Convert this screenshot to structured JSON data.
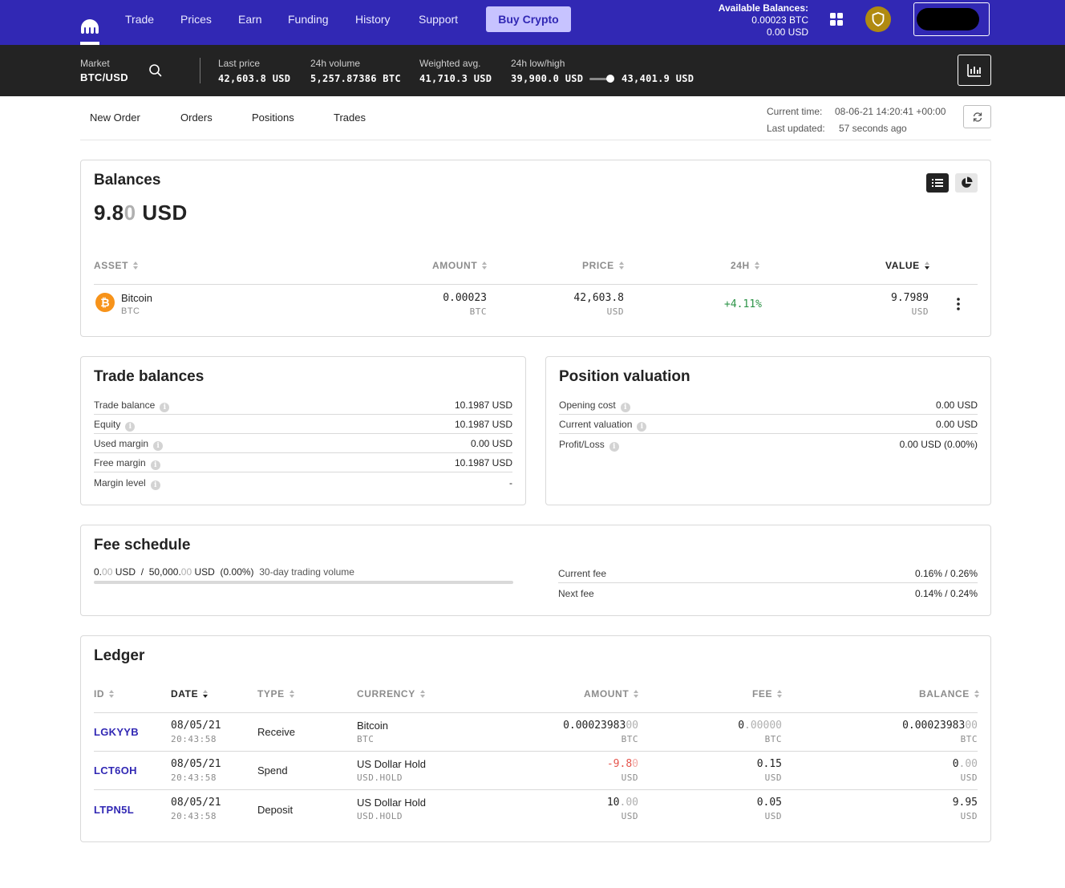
{
  "nav": {
    "items": [
      "Trade",
      "Prices",
      "Earn",
      "Funding",
      "History",
      "Support"
    ],
    "buy_label": "Buy Crypto",
    "available_title": "Available Balances:",
    "available_btc": "0.00023 BTC",
    "available_usd": "0.00 USD",
    "brand_color": "#3128b4",
    "logo_icon": "kraken-logo-icon",
    "apps_icon": "grid-icon",
    "security_icon": "shield-icon"
  },
  "market": {
    "market_label": "Market",
    "pair": "BTC/USD",
    "last_price_label": "Last price",
    "last_price": "42,603.8 USD",
    "volume_label": "24h volume",
    "volume": "5,257.87386 BTC",
    "wavg_label": "Weighted avg.",
    "wavg": "41,710.3 USD",
    "lowhigh_label": "24h low/high",
    "low": "39,900.0 USD",
    "high": "43,401.9 USD"
  },
  "tabs": [
    "New Order",
    "Orders",
    "Positions",
    "Trades"
  ],
  "times": {
    "current_label": "Current time:",
    "current_value": "08-06-21 14:20:41 +00:00",
    "updated_label": "Last updated:",
    "updated_value": "57 seconds ago"
  },
  "balances": {
    "title": "Balances",
    "total_main": "9.8",
    "total_dim": "0",
    "total_unit": "USD",
    "headers": [
      "ASSET",
      "AMOUNT",
      "PRICE",
      "24H",
      "VALUE"
    ],
    "rows": [
      {
        "name": "Bitcoin",
        "symbol": "BTC",
        "amount": "0.00023",
        "amount_unit": "BTC",
        "price": "42,603.8",
        "price_unit": "USD",
        "change": "+4.11%",
        "value": "9.7989",
        "value_unit": "USD"
      }
    ]
  },
  "trade_balances": {
    "title": "Trade balances",
    "rows": [
      {
        "label": "Trade balance",
        "value": "10.1987 USD"
      },
      {
        "label": "Equity",
        "value": "10.1987 USD"
      },
      {
        "label": "Used margin",
        "value": "0.00 USD"
      },
      {
        "label": "Free margin",
        "value": "10.1987 USD"
      },
      {
        "label": "Margin level",
        "value": "-"
      }
    ]
  },
  "position_valuation": {
    "title": "Position valuation",
    "rows": [
      {
        "label": "Opening cost",
        "value": "0.00 USD"
      },
      {
        "label": "Current valuation",
        "value": "0.00 USD"
      },
      {
        "label": "Profit/Loss",
        "value": "0.00 USD (0.00%)"
      }
    ]
  },
  "fee_schedule": {
    "title": "Fee schedule",
    "vol_main": "0.",
    "vol_dim": "00",
    "vol_unit": "USD",
    "slash": "/",
    "limit_main": "50,000.",
    "limit_dim": "00",
    "limit_unit": "USD",
    "pct": "(0.00%)",
    "desc": "30-day trading volume",
    "progress": 0,
    "current_fee_label": "Current fee",
    "current_fee": "0.16% / 0.26%",
    "next_fee_label": "Next fee",
    "next_fee": "0.14% / 0.24%"
  },
  "ledger": {
    "title": "Ledger",
    "headers": [
      "ID",
      "DATE",
      "TYPE",
      "CURRENCY",
      "AMOUNT",
      "FEE",
      "BALANCE"
    ],
    "rows": [
      {
        "id": "LGKYYB",
        "date": "08/05/21",
        "time": "20:43:58",
        "type": "Receive",
        "currency": "Bitcoin",
        "currency_code": "BTC",
        "amount_main": "0.00023983",
        "amount_dim": "00",
        "amount_unit": "BTC",
        "fee_main": "0",
        "fee_dim": ".00000",
        "fee_unit": "BTC",
        "balance_main": "0.00023983",
        "balance_dim": "00",
        "balance_unit": "BTC"
      },
      {
        "id": "LCT6OH",
        "date": "08/05/21",
        "time": "20:43:58",
        "type": "Spend",
        "currency": "US Dollar Hold",
        "currency_code": "USD.HOLD",
        "amount_main": "-9.8",
        "amount_dim": "0",
        "amount_unit": "USD",
        "fee_main": "0.15",
        "fee_dim": "",
        "fee_unit": "USD",
        "balance_main": "0",
        "balance_dim": ".00",
        "balance_unit": "USD"
      },
      {
        "id": "LTPN5L",
        "date": "08/05/21",
        "time": "20:43:58",
        "type": "Deposit",
        "currency": "US Dollar Hold",
        "currency_code": "USD.HOLD",
        "amount_main": "10",
        "amount_dim": ".00",
        "amount_unit": "USD",
        "fee_main": "0.05",
        "fee_dim": "",
        "fee_unit": "USD",
        "balance_main": "9.95",
        "balance_dim": "",
        "balance_unit": "USD"
      }
    ]
  }
}
